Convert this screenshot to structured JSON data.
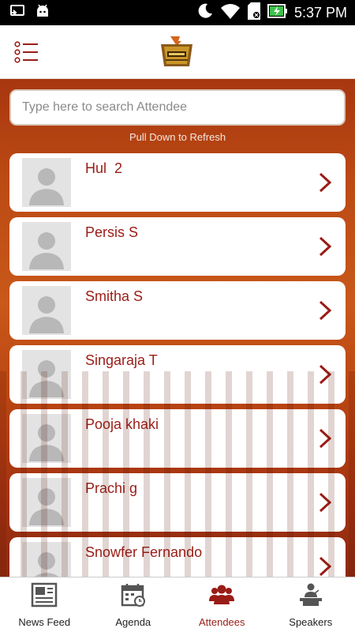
{
  "status_bar": {
    "time": "5:37 PM",
    "icons": [
      "screen-cast-icon",
      "android-icon",
      "do-not-disturb-icon",
      "wifi-icon",
      "sd-card-icon",
      "battery-charging-icon"
    ]
  },
  "header": {
    "menu_icon": "list-menu-icon",
    "logo_icon": "event-logo"
  },
  "search": {
    "placeholder": "Type here to search Attendee",
    "value": ""
  },
  "refresh_hint": "Pull Down to Refresh",
  "attendees": [
    {
      "name": "Hul  2"
    },
    {
      "name": "Persis S"
    },
    {
      "name": "Smitha S"
    },
    {
      "name": "Singaraja T"
    },
    {
      "name": "Pooja khaki"
    },
    {
      "name": "Prachi g"
    },
    {
      "name": "Snowfer Fernando"
    }
  ],
  "bottom_nav": {
    "items": [
      {
        "label": "News Feed",
        "icon": "news-feed-icon",
        "active": false
      },
      {
        "label": "Agenda",
        "icon": "calendar-icon",
        "active": false
      },
      {
        "label": "Attendees",
        "icon": "people-icon",
        "active": true
      },
      {
        "label": "Speakers",
        "icon": "speaker-podium-icon",
        "active": false
      }
    ]
  },
  "colors": {
    "accent": "#9a1c16",
    "background_top": "#a8360f",
    "background_mid": "#c9581a",
    "card": "#ffffff",
    "inactive_icon": "#555555"
  }
}
